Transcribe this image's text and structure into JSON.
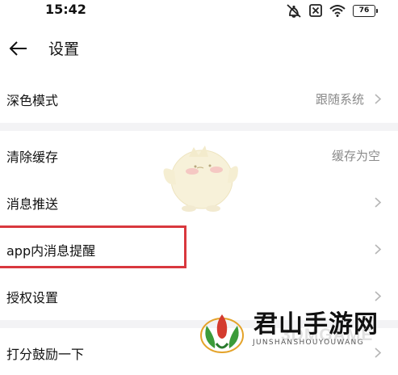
{
  "status_bar": {
    "time": "15:42",
    "battery": "76"
  },
  "header": {
    "title": "设置"
  },
  "settings": {
    "dark_mode": {
      "label": "深色模式",
      "value": "跟随系统"
    },
    "clear_cache": {
      "label": "清除缓存",
      "value": "缓存为空"
    },
    "push": {
      "label": "消息推送"
    },
    "in_app": {
      "label": "app内消息提醒"
    },
    "permissions": {
      "label": "授权设置"
    },
    "rate": {
      "label": "打分鼓励一下"
    }
  },
  "watermark": {
    "title": "君山手游网",
    "subtitle": "JUNSHANSHOUYOUWANG",
    "overlay": "3DMGAME"
  },
  "colors": {
    "divider": "#f3f3f5",
    "highlight": "#d9383e",
    "secondary_text": "#8a8a8a",
    "chevron": "#b5b5b5"
  },
  "icons": [
    "back-arrow-icon",
    "mute-icon",
    "sim-off-icon",
    "wifi-icon",
    "battery-icon",
    "chevron-right-icon"
  ]
}
